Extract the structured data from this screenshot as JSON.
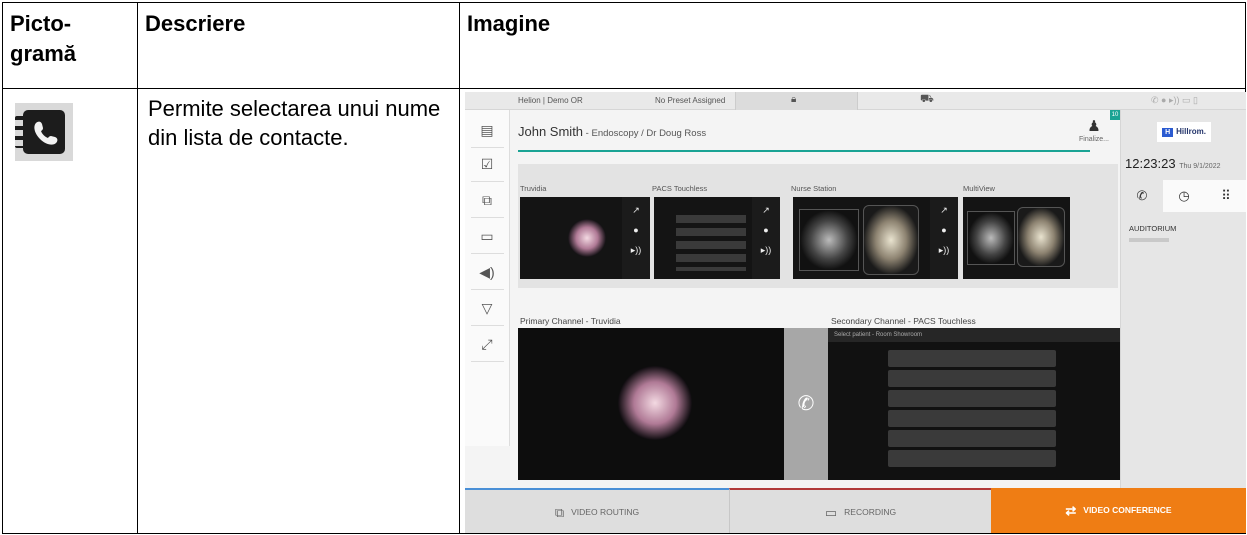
{
  "table": {
    "headers": [
      "Picto-\ngramă",
      "Descriere",
      "Imagine"
    ],
    "row": {
      "icon": "contacts-book-phone-icon",
      "description": "Permite selectarea unui nume din lista de contacte."
    }
  },
  "ui": {
    "room": "Helion | Demo OR",
    "preset": "No Preset Assigned",
    "patient_name": "John Smith",
    "patient_detail": " - Endoscopy / Dr Doug Ross",
    "finalize": "Finalize...",
    "notification_count": "10",
    "brand": "Hillrom.",
    "brand_mark": "H",
    "time": "12:23:23",
    "date": "Thu 9/1/2022",
    "contact": "AUDITORIUM",
    "sources": [
      "Truvidia",
      "PACS Touchless",
      "Nurse Station",
      "MultiView"
    ],
    "primary_channel": "Primary Channel - Truvidia",
    "secondary_channel": "Secondary Channel - PACS Touchless",
    "secondary_header": "Select patient - Room Showroom",
    "tabs": {
      "video_routing": "VIDEO ROUTING",
      "recording": "RECORDING",
      "video_conference": "VIDEO CONFERENCE"
    },
    "colors": {
      "accent": "#1aa394",
      "conference": "#ef7d14",
      "routing_line": "#4a8fd6",
      "recording_line": "#b13a3a"
    }
  }
}
